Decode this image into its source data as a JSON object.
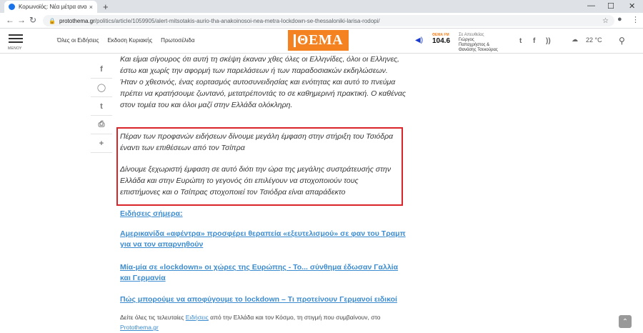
{
  "browser": {
    "tab_title": "Κορωνοϊός: Νέα μέτρα ανακοιν...",
    "tab_close": "×",
    "new_tab": "+",
    "url_host": "protothema.gr",
    "url_path": "/politics/article/1059905/alert-mitsotakis-aurio-tha-anakoinosoi-nea-metra-lockdown-se-thessaloniki-larisa-rodopi/",
    "win_minimize": "—",
    "win_maximize": "☐",
    "win_close": "✕"
  },
  "header": {
    "menu_label": "ΜΕΝΟΥ",
    "nav": [
      "Όλες οι Ειδήσεις",
      "Εκδοση Κυριακής",
      "Πρωτοσέλιδα"
    ],
    "logo_text": "ΘΕΜΑ",
    "radio_freq": "104.6",
    "radio_fm": "ΘΕΜΑ FM",
    "onair_live": "Σε Απευθείας",
    "onair_hosts": "Γιώργος Παπαχρήστος & Θανάσης Τσεκούρας",
    "temperature": "22 °C"
  },
  "article": {
    "intro": "Και είμαι σίγουρος ότι αυτή τη σκέψη έκαναν χθες όλες οι Ελληνίδες, όλοι οι Ελληνες, έστω και χωρίς την αφορμή των παρελάσεων ή των παραδοσιακών εκδηλώσεων. Ήταν ο χθεσινός, ένας εορτασμός αυτοσυνειδησίας και ενότητας και αυτό το πνεύμα πρέπει να κρατήσουμε ζωντανό, μετατρέποντάς το σε καθημερινή πρακτική. Ο καθένας στον τομέα του και όλοι μαζί στην Ελλάδα ολόκληρη.",
    "quote1": "Πέραν των προφανών ειδήσεων δίνουμε μεγάλη έμφαση στην στήριξη του Τσιόδρα έναντι των επιθέσεων από τον Τσίπρα",
    "quote2": "Δίνουμε ξεχωριστή έμφαση σε αυτό διότι την ώρα της μεγάλης συστράτευσής στην Ελλάδα και στην Ευρώπη το γεγονός ότι επιλέγουν να στοχοποιούν τους επιστήμονες και ο Τσίπρας στοχοποιεί τον Τσιόδρα είναι απαράδεκτο",
    "related_heading": "Ειδήσεις σήμερα:",
    "related": [
      "Αμερικανίδα «αφέντρα» προσφέρει θεραπεία «εξευτελισμού» σε φαν του Τραμπ για να τον απαρνηθούν",
      "Μία-μία σε «lockdown» οι χώρες της Ευρώπης - Το... σύνθημα έδωσαν Γαλλία και Γερμανία",
      "Πώς μπορούμε να αποφύγουμε το lockdown – Τι προτείνουν Γερμανοί ειδικοί"
    ],
    "footer_pre": "Δείτε όλες τις τελευταίες ",
    "footer_link1": "Ειδήσεις",
    "footer_mid": " από την Ελλάδα και τον Κόσμο, τη στιγμή που συμβαίνουν, στο",
    "footer_link2": "Protothema.gr"
  }
}
